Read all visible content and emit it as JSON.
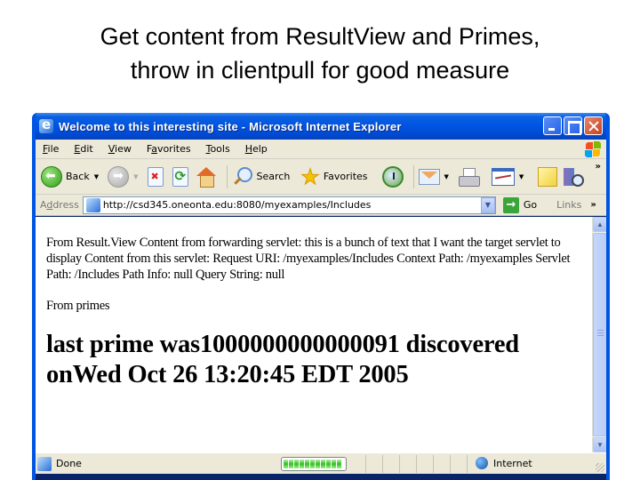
{
  "slide": {
    "title_line1": "Get content from ResultView and Primes,",
    "title_line2": "throw in clientpull for good measure"
  },
  "window": {
    "title": "Welcome to this interesting site - Microsoft Internet Explorer",
    "buttons": {
      "minimize": "minimize",
      "maximize": "maximize",
      "close": "close"
    }
  },
  "menu": {
    "items": [
      {
        "accel": "F",
        "rest": "ile"
      },
      {
        "accel": "E",
        "rest": "dit"
      },
      {
        "accel": "V",
        "rest": "iew"
      },
      {
        "pre": "F",
        "accel": "a",
        "rest": "vorites"
      },
      {
        "accel": "T",
        "rest": "ools"
      },
      {
        "accel": "H",
        "rest": "elp"
      }
    ]
  },
  "toolbar": {
    "back_label": "Back",
    "search_label": "Search",
    "favorites_label": "Favorites",
    "overflow": "»"
  },
  "address": {
    "label": "Address",
    "label_accel": "d",
    "url": "http://csd345.oneonta.edu:8080/myexamples/Includes",
    "go_label": "Go",
    "links_label": "Links",
    "links_overflow": "»"
  },
  "page": {
    "resultview_text": "From Result.View Content from forwarding servlet: this is a bunch of text that I want the target servlet to display Content from this servlet: Request URI: /myexamples/Includes Context Path: /myexamples Servlet Path: /Includes Path Info: null Query String: null",
    "primes_label": "From primes",
    "prime_heading_line1": "last prime was1000000000000091 discovered",
    "prime_heading_line2": "onWed Oct 26 13:20:45 EDT 2005"
  },
  "status": {
    "text": "Done",
    "progress_percent": 100,
    "zone": "Internet"
  }
}
